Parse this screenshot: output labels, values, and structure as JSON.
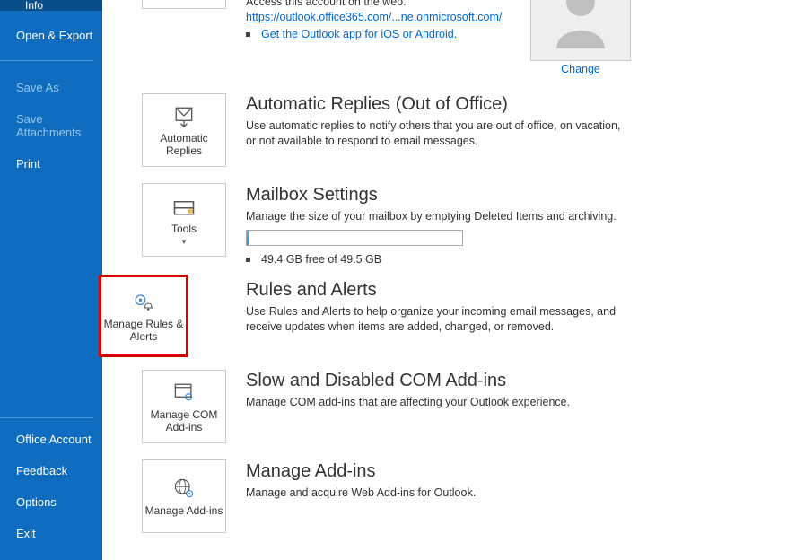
{
  "sidebar": {
    "info": "Info",
    "open_export": "Open & Export",
    "save_as": "Save As",
    "save_attachments": "Save Attachments",
    "print": "Print",
    "office_account": "Office Account",
    "feedback": "Feedback",
    "options": "Options",
    "exit": "Exit"
  },
  "account": {
    "access_text": "Access this account on the web.",
    "url": "https://outlook.office365.com/...ne.onmicrosoft.com/",
    "get_app": "Get the Outlook app for iOS or Android.",
    "change": "Change"
  },
  "tiles": {
    "automatic_replies": "Automatic Replies",
    "tools": "Tools",
    "manage_rules": "Manage Rules & Alerts",
    "manage_com": "Manage COM Add-ins",
    "manage_addins": "Manage Add-ins"
  },
  "sections": {
    "auto": {
      "title": "Automatic Replies (Out of Office)",
      "desc": "Use automatic replies to notify others that you are out of office, on vacation, or not available to respond to email messages."
    },
    "mailbox": {
      "title": "Mailbox Settings",
      "desc": "Manage the size of your mailbox by emptying Deleted Items and archiving.",
      "storage": "49.4 GB free of 49.5 GB"
    },
    "rules": {
      "title": "Rules and Alerts",
      "desc": "Use Rules and Alerts to help organize your incoming email messages, and receive updates when items are added, changed, or removed."
    },
    "com": {
      "title": "Slow and Disabled COM Add-ins",
      "desc": "Manage COM add-ins that are affecting your Outlook experience."
    },
    "addins": {
      "title": "Manage Add-ins",
      "desc": "Manage and acquire Web Add-ins for Outlook."
    }
  }
}
